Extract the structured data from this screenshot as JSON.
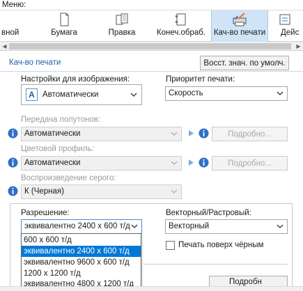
{
  "menu_label": "Меню:",
  "tabs": [
    {
      "label": "вной"
    },
    {
      "label": "Бумага"
    },
    {
      "label": "Правка"
    },
    {
      "label": "Конеч.обраб."
    },
    {
      "label": "Кач-во печати"
    },
    {
      "label": "Дейс"
    }
  ],
  "section": {
    "title": "Кач-во печати",
    "restore_button": "Восст. знач. по умолч."
  },
  "image_settings": {
    "label": "Настройки для изображения:",
    "value": "Автоматически",
    "icon_letter": "A"
  },
  "print_priority": {
    "label": "Приоритет печати:",
    "value": "Скорость"
  },
  "halftone": {
    "label": "Передача полутонов:",
    "value": "Автоматически",
    "details_button": "Подробно..."
  },
  "color_profile": {
    "label": "Цветовой профиль:",
    "value": "Автоматически",
    "details_button": "Подробно..."
  },
  "gray_reproduction": {
    "label": "Воспроизведение серого:",
    "value": "К (Черная)"
  },
  "resolution": {
    "label": "Разрешение:",
    "value": "эквивалентно 2400 x 600 т/д",
    "options": [
      "600 x 600 т/д",
      "эквивалентно 2400 x 600 т/д",
      "эквивалентно 9600 x 600 т/д",
      "1200 x 1200 т/д",
      "эквивалентно 4800 x 1200 т/д"
    ],
    "selected_index": 1
  },
  "vector_raster": {
    "label": "Векторный/Растровый:",
    "value": "Векторный"
  },
  "print_over_black": {
    "label": "Печать поверх чёрным",
    "checked": false
  },
  "partial_button": "Подробн",
  "colors": {
    "accent": "#0078d7",
    "tab_active": "#cfe4f7",
    "section_title": "#1f5fa8"
  }
}
